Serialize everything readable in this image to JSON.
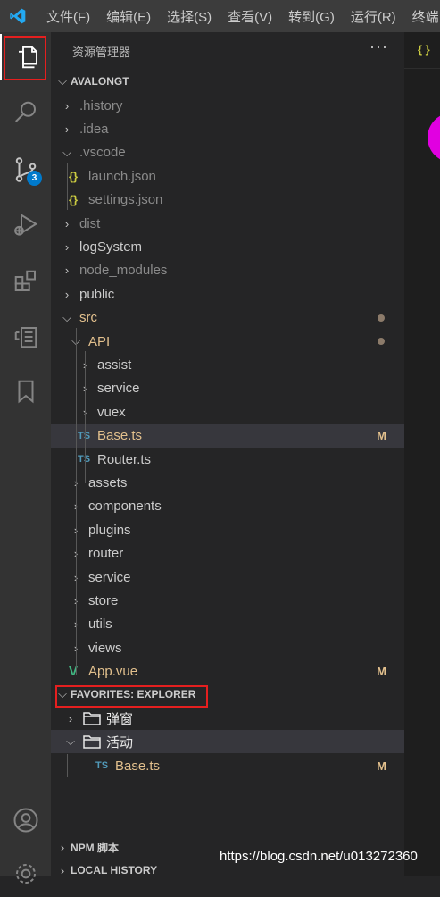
{
  "menu": [
    "文件(F)",
    "编辑(E)",
    "选择(S)",
    "查看(V)",
    "转到(G)",
    "运行(R)",
    "终端"
  ],
  "activity_badge": "3",
  "sidebar": {
    "title": "资源管理器",
    "more": "···",
    "workspace": "AVALONGT"
  },
  "tree": [
    {
      "label": ".history",
      "kind": "folder",
      "state": "collapsed",
      "dim": true
    },
    {
      "label": ".idea",
      "kind": "folder",
      "state": "collapsed",
      "dim": true
    },
    {
      "label": ".vscode",
      "kind": "folder",
      "state": "expanded",
      "dim": true
    },
    {
      "label": "launch.json",
      "kind": "json",
      "dim": true
    },
    {
      "label": "settings.json",
      "kind": "json",
      "dim": true
    },
    {
      "label": "dist",
      "kind": "folder",
      "state": "collapsed",
      "dim": true
    },
    {
      "label": "logSystem",
      "kind": "folder",
      "state": "collapsed"
    },
    {
      "label": "node_modules",
      "kind": "folder",
      "state": "collapsed",
      "dim": true
    },
    {
      "label": "public",
      "kind": "folder",
      "state": "collapsed"
    },
    {
      "label": "src",
      "kind": "folder",
      "state": "expanded",
      "modified": true
    },
    {
      "label": "API",
      "kind": "folder",
      "state": "expanded",
      "modified": true
    },
    {
      "label": "assist",
      "kind": "folder",
      "state": "collapsed"
    },
    {
      "label": "service",
      "kind": "folder",
      "state": "collapsed"
    },
    {
      "label": "vuex",
      "kind": "folder",
      "state": "collapsed"
    },
    {
      "label": "Base.ts",
      "kind": "ts",
      "status": "M",
      "selected": true
    },
    {
      "label": "Router.ts",
      "kind": "ts"
    },
    {
      "label": "assets",
      "kind": "folder",
      "state": "collapsed"
    },
    {
      "label": "components",
      "kind": "folder",
      "state": "collapsed"
    },
    {
      "label": "plugins",
      "kind": "folder",
      "state": "collapsed"
    },
    {
      "label": "router",
      "kind": "folder",
      "state": "collapsed"
    },
    {
      "label": "service",
      "kind": "folder",
      "state": "collapsed"
    },
    {
      "label": "store",
      "kind": "folder",
      "state": "collapsed"
    },
    {
      "label": "utils",
      "kind": "folder",
      "state": "collapsed"
    },
    {
      "label": "views",
      "kind": "folder",
      "state": "collapsed"
    },
    {
      "label": "App.vue",
      "kind": "vue",
      "status": "M"
    }
  ],
  "file_type_labels": {
    "ts": "TS",
    "json": "{}"
  },
  "favorites": {
    "title": "FAVORITES: EXPLORER",
    "items": [
      {
        "label": "弹窗",
        "state": "collapsed"
      },
      {
        "label": "活动",
        "state": "expanded"
      },
      {
        "label": "Base.ts",
        "kind": "ts",
        "status": "M"
      }
    ]
  },
  "npm_section": "NPM 脚本",
  "local_history_section": "LOCAL HISTORY",
  "watermark": "https://blog.csdn.net/u013272360",
  "colors": {
    "highlight": "#e51f1f",
    "badge": "#007acc",
    "modified": "#e2c08d",
    "ts": "#519aba",
    "json": "#cbcb41",
    "vue": "#41b883"
  }
}
